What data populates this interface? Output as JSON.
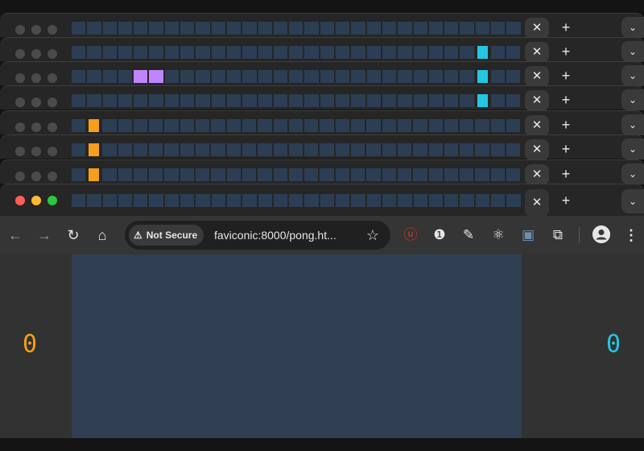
{
  "windows": [
    {
      "active": false,
      "lit": []
    },
    {
      "active": false,
      "lit": [
        {
          "index": 26,
          "color": "cyan"
        }
      ]
    },
    {
      "active": false,
      "lit": [
        {
          "index": 4,
          "color": "purple"
        },
        {
          "index": 5,
          "color": "purple"
        },
        {
          "index": 26,
          "color": "cyan"
        }
      ]
    },
    {
      "active": false,
      "lit": [
        {
          "index": 26,
          "color": "cyan"
        }
      ]
    },
    {
      "active": false,
      "lit": [
        {
          "index": 1,
          "color": "orange"
        }
      ]
    },
    {
      "active": false,
      "lit": [
        {
          "index": 1,
          "color": "orange"
        }
      ]
    },
    {
      "active": false,
      "lit": [
        {
          "index": 1,
          "color": "orange"
        }
      ]
    },
    {
      "active": true,
      "lit": []
    }
  ],
  "tab_count": 29,
  "tab_strip": {
    "close_icon": "close-icon",
    "close_glyph": "✕",
    "new_tab_icon": "plus-icon",
    "new_tab_glyph": "+",
    "tab_search_icon": "chevron-down-icon",
    "tab_search_glyph": "⌄"
  },
  "toolbar": {
    "back_glyph": "←",
    "forward_glyph": "→",
    "reload_glyph": "↻",
    "home_glyph": "⌂",
    "security_label": "Not Secure",
    "security_glyph": "⚠",
    "url": "faviconic:8000/pong.ht...",
    "bookmark_glyph": "☆",
    "menu_glyph": "⋮",
    "extensions": [
      {
        "name": "ublock-icon",
        "glyph": "ⓤ"
      },
      {
        "name": "onepassword-icon",
        "glyph": "❶"
      },
      {
        "name": "pen-icon",
        "glyph": "✎"
      },
      {
        "name": "react-devtools-icon",
        "glyph": "⚛"
      },
      {
        "name": "image-extension-icon",
        "glyph": "▣"
      },
      {
        "name": "extensions-puzzle-icon",
        "glyph": "⧉"
      }
    ]
  },
  "game": {
    "left_score": "0",
    "right_score": "0"
  },
  "colors": {
    "orange": "#f59f1c",
    "cyan": "#23c6e2",
    "purple": "#c084fc",
    "court": "#2f3e52"
  }
}
